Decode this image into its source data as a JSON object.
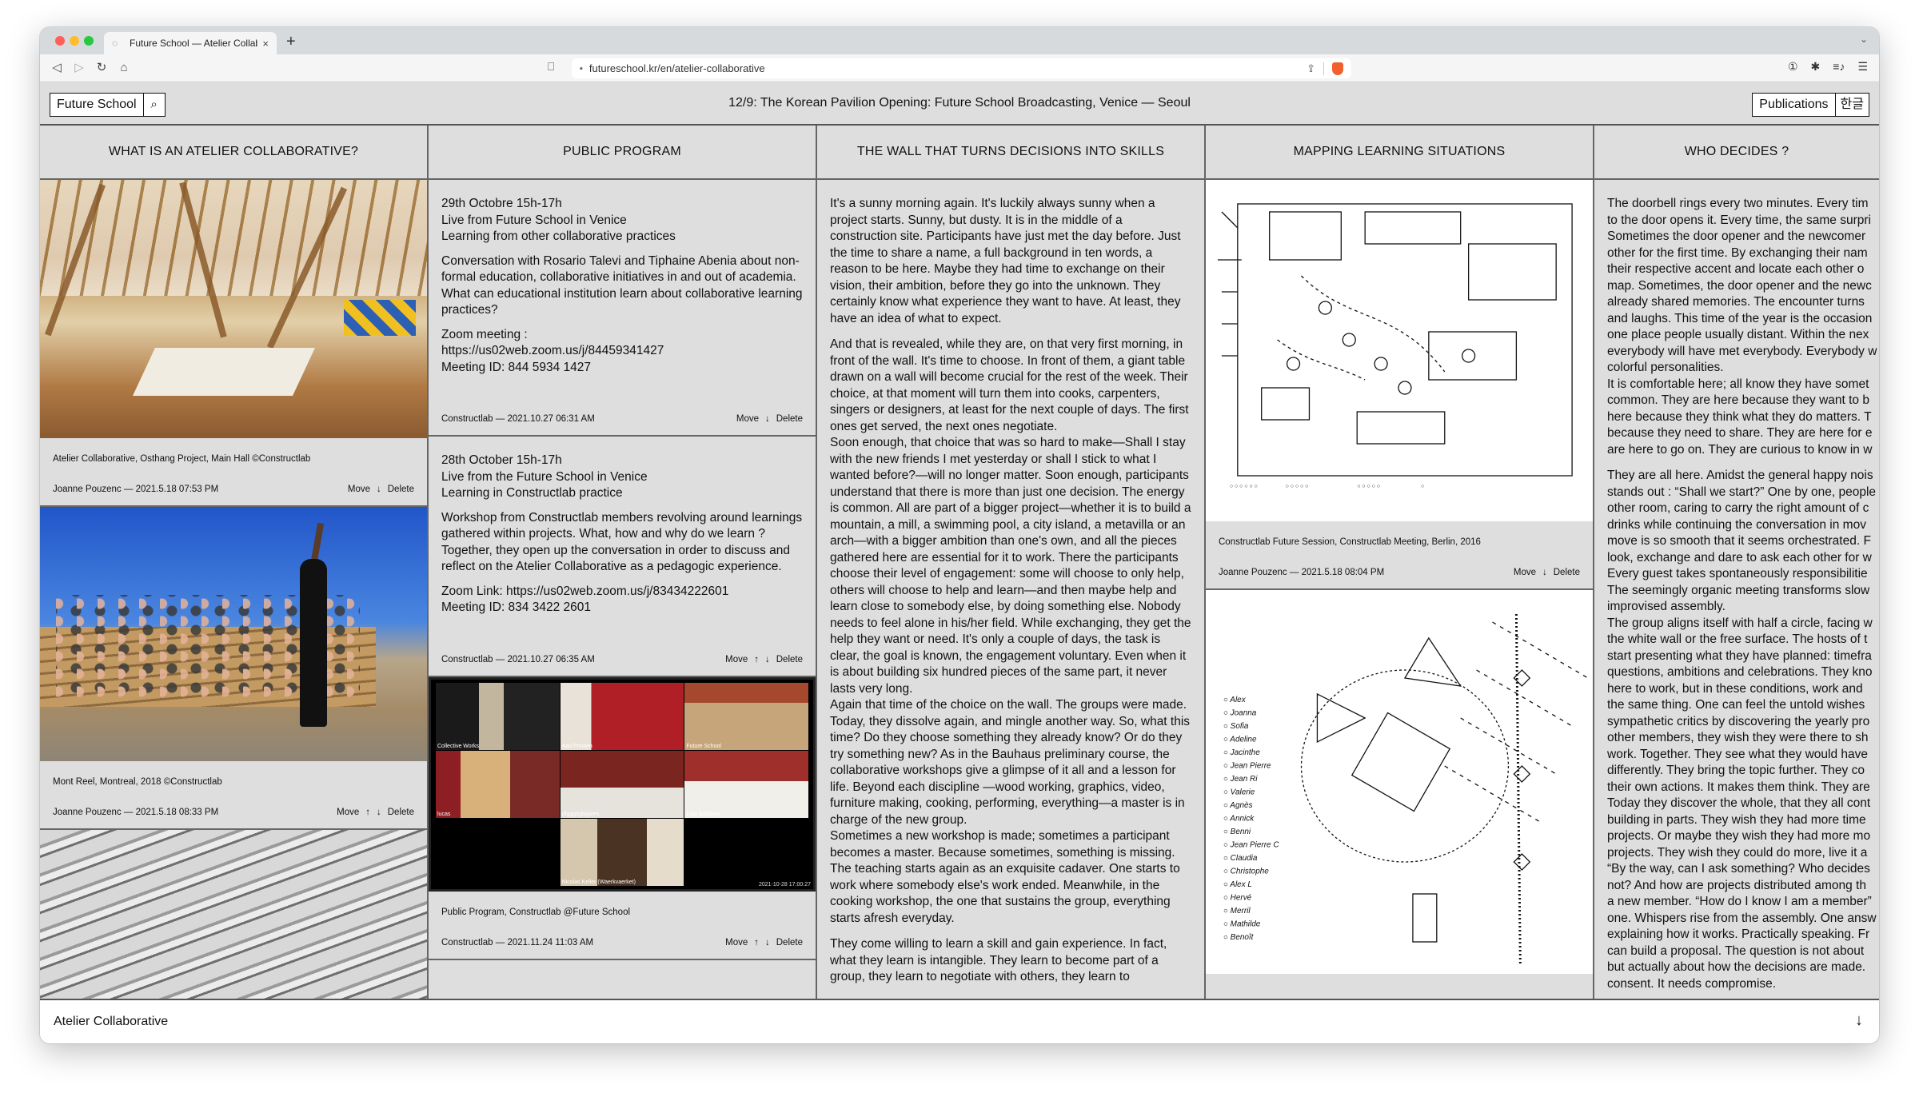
{
  "browser": {
    "tab_title": "Future School — Atelier Collabo",
    "tab_close": "×",
    "new_tab": "+",
    "tab_chevron": "⌄",
    "nav_back": "◁",
    "nav_forward": "▷",
    "nav_reload": "↻",
    "nav_home": "⌂",
    "bookmark_icon": "⎕",
    "lock_icon": "🔒",
    "url": "futureschool.kr/en/atelier-collaborative",
    "share_icon": "⇪",
    "right_icons": [
      "①",
      "✱",
      "≡♪",
      "☰"
    ]
  },
  "header": {
    "brand": "Future School",
    "search_icon": "⌕",
    "announcement": "12/9: The Korean Pavilion Opening: Future School Broadcasting, Venice — Seoul",
    "publications": "Publications",
    "language": "한글"
  },
  "columns": [
    {
      "title": "WHAT IS AN ATELIER COLLABORATIVE?",
      "cards": [
        {
          "caption": "Atelier Collaborative, Osthang Project, Main Hall ©Constructlab",
          "author_date": "Joanne Pouzenc — 2021.5.18 07:53 PM",
          "move": "Move",
          "up": "",
          "down": "↓",
          "delete": "Delete"
        },
        {
          "caption": "Mont Reel, Montreal, 2018 ©Constructlab",
          "author_date": "Joanne Pouzenc — 2021.5.18 08:33 PM",
          "move": "Move",
          "up": "↑",
          "down": "↓",
          "delete": "Delete"
        }
      ]
    },
    {
      "title": "PUBLIC PROGRAM",
      "items": [
        {
          "heading_lines": [
            "29th Octobre 15h-17h",
            "Live from Future School in Venice",
            "Learning from other collaborative practices"
          ],
          "body": "Conversation with Rosario Talevi and Tiphaine Abenia about non-formal education, collaborative initiatives in and out of academia. What can educational institution learn about collaborative learning practices?",
          "link_lines": [
            "Zoom meeting :",
            "https://us02web.zoom.us/j/84459341427",
            "Meeting ID: 844 5934 1427"
          ],
          "author_date": "Constructlab — 2021.10.27 06:31 AM",
          "move": "Move",
          "up": "",
          "down": "↓",
          "delete": "Delete"
        },
        {
          "heading_lines": [
            "28th October 15h-17h",
            "Live from the Future School in Venice",
            "Learning in Constructlab practice"
          ],
          "body": "Workshop from Constructlab members revolving around learnings gathered within projects. What, how and why do we learn ? Together, they open up the conversation in order to discuss and reflect on the Atelier Collaborative as a pedagogic experience.",
          "link_lines": [
            "Zoom Link: https://us02web.zoom.us/j/83434222601",
            "Meeting ID: 834 3422 2601"
          ],
          "author_date": "Constructlab — 2021.10.27 06:35 AM",
          "move": "Move",
          "up": "↑",
          "down": "↓",
          "delete": "Delete"
        }
      ],
      "zoom_card": {
        "tile_labels": [
          "Collective Works",
          "Aad Prinsen",
          "Future School",
          "lucas",
          "dfgggbgbgares",
          "Lola Soldaoni",
          "",
          "Nicolas Keller (Waerkvaerket)",
          ""
        ],
        "stamp": "2021-10-28 17:00:27",
        "caption": "Public Program, Constructlab @Future School",
        "author_date": "Constructlab — 2021.11.24 11:03 AM",
        "move": "Move",
        "up": "↑",
        "down": "↓",
        "delete": "Delete"
      }
    },
    {
      "title": "THE WALL THAT TURNS DECISIONS INTO SKILLS",
      "paragraphs": [
        "It's a sunny morning again. It's luckily always sunny when a project starts. Sunny, but dusty. It is in the middle of a construction site. Participants have just met the day before. Just the time to share a name, a full background in ten words, a reason to be here. Maybe they had time to exchange on their vision, their ambition, before they go into the unknown. They certainly know what experience they want to have. At least, they have an idea of what to expect.",
        "And that is revealed, while they are, on that very first morning, in front of the wall. It's time to choose. In front of them, a giant table drawn on a wall will become crucial for the rest of the week. Their choice, at that moment will turn them into cooks, carpenters, singers or designers, at least for the next couple of days. The first ones get served, the next ones negotiate.",
        "Soon enough, that choice that was so hard to make—Shall I stay with the new friends I met yesterday or shall I stick to what I wanted before?—will no longer matter. Soon enough, participants understand that there is more than just one decision. The energy is common. All are part of a bigger project—whether it is to build a mountain, a mill, a swimming pool, a city island, a metavilla or an arch—with a bigger ambition than one's own, and all the pieces gathered here are essential for it to work. There the participants choose their level of engagement: some will choose to only help, others will choose to help and learn—and then maybe help and learn close to somebody else, by doing something else. Nobody needs to feel alone in his/her field. While exchanging, they get the help they want or need. It's only a couple of days, the task is clear, the goal is known, the engagement voluntary. Even when it is about building six hundred pieces of the same part, it never lasts very long.",
        "Again that time of the choice on the wall. The groups were made. Today, they dissolve again, and mingle another way. So, what this time? Do they choose something they already know? Or do they try something new? As in the Bauhaus preliminary course, the collaborative workshops give a glimpse of it all and a lesson for life. Beyond each discipline —wood working, graphics, video, furniture making, cooking, performing, everything—a master is in charge of the new group.",
        "Sometimes a new workshop is made; sometimes a participant becomes a master. Because sometimes, something is missing. The teaching starts again as an exquisite cadaver. One starts to work where somebody else's work ended. Meanwhile, in the cooking workshop, the one that sustains the group, everything starts afresh everyday.",
        "They come willing to learn a skill and gain experience. In fact, what they learn is intangible. They learn to become part of a group, they learn to negotiate with others, they learn to"
      ]
    },
    {
      "title": "MAPPING LEARNING SITUATIONS",
      "cards": [
        {
          "caption": "Constructlab Future Session, Constructlab Meeting, Berlin, 2016",
          "author_date": "Joanne Pouzenc — 2021.5.18 08:04 PM",
          "move": "Move",
          "up": "",
          "down": "↓",
          "delete": "Delete"
        }
      ],
      "sketch_names": [
        "Alex",
        "Joanna",
        "Sofia",
        "Adeline",
        "Jacinthe",
        "Jean Pierre",
        "Jean Ri",
        "Valerie",
        "Agnès",
        "Annick",
        "Benni",
        "Jean Pierre C",
        "Claudia",
        "Christophe",
        "Alex L",
        "Hervé",
        "Merril",
        "Mathilde",
        "Benoît"
      ]
    },
    {
      "title": "WHO DECIDES ?",
      "lines_a": [
        "The doorbell rings every two minutes. Every tim",
        "to the door opens it. Every time, the same surpri",
        "Sometimes the door opener and the newcomer",
        "other for the first time. By exchanging their nam",
        "their respective accent and locate each other o",
        "map. Sometimes, the door opener and the newc",
        "already shared memories. The encounter turns",
        "and laughs. This time of the year is the occasion",
        "one place people usually distant. Within the nex",
        "everybody will have met everybody. Everybody w",
        "colorful personalities.",
        "It is comfortable here; all know they have somet",
        "common. They are here because they want to b",
        "here because they think what they do matters. T",
        "because they need to share. They are here for e",
        "are here to go on. They are curious to know in w"
      ],
      "lines_b": [
        "They are all here. Amidst the general happy nois",
        "stands out : “Shall we start?” One by one, people",
        "other room, caring to carry the right amount of c",
        "drinks while continuing the conversation in mov",
        "move is so smooth that it seems orchestrated. F",
        "look, exchange and dare to ask each other for w",
        "Every guest takes spontaneously responsibilitie",
        "The seemingly organic meeting transforms slow",
        "improvised assembly.",
        "The group aligns itself with half a circle, facing w",
        "the white wall or the free surface. The hosts of t",
        "start presenting what they have planned: timefra",
        "questions, ambitions and celebrations. They kno",
        "here to work, but in these conditions, work and",
        "the same thing. One can feel the untold wishes",
        "sympathetic critics by discovering the yearly pro",
        "other members, they wish they were there to sh",
        "work. Together. They see what they would have",
        "differently. They bring the topic further. They co",
        "their own actions. It makes them think. They are",
        "Today they discover the whole, that they all cont",
        "building in parts. They wish they had more time",
        "projects. Or maybe they wish they had more mo",
        "projects. They wish they could do more, live it a",
        "“By the way, can I ask something? Who decides",
        "not? And how are projects distributed among th",
        "a new member. “How do I know I am a member”",
        "one. Whispers rise from the assembly. One answ",
        "explaining how it works. Practically speaking. Fr",
        "can build a proposal. The question is not about",
        "but actually about how the decisions are made.",
        "consent. It needs compromise."
      ]
    }
  ],
  "footer": {
    "title": "Atelier Collaborative",
    "arrow": "↓"
  }
}
